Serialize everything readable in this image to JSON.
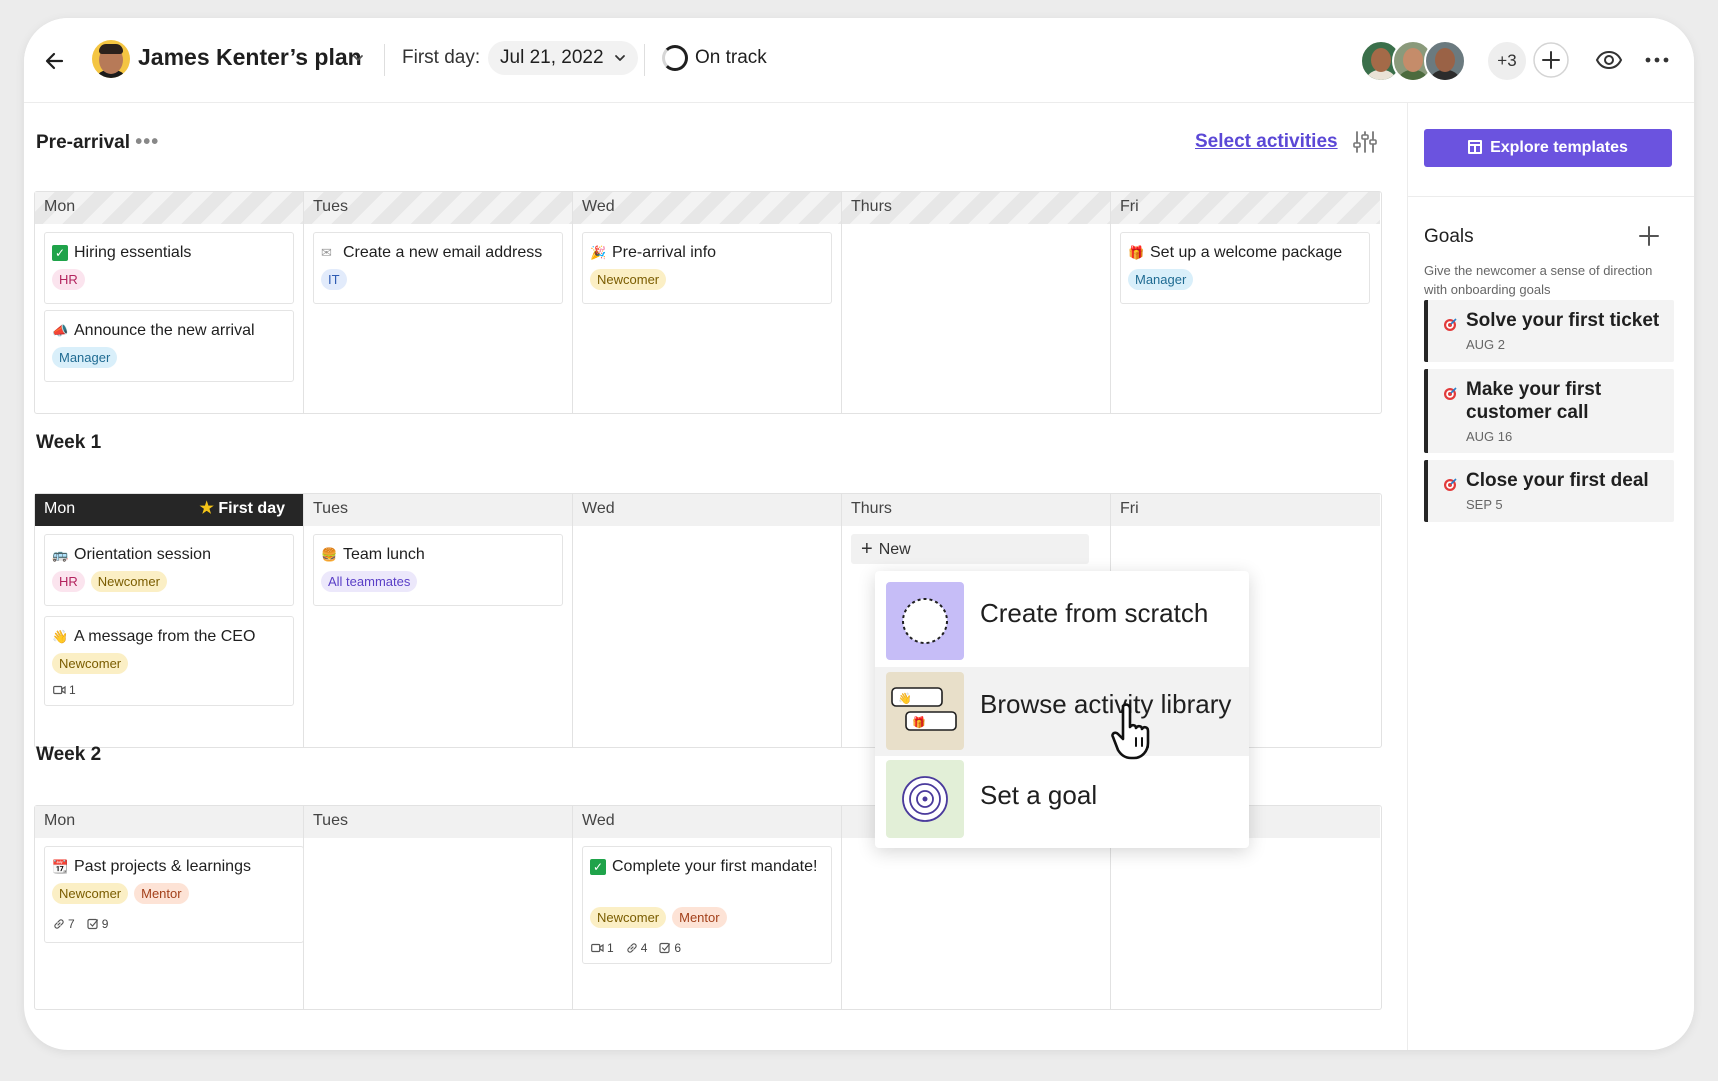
{
  "header": {
    "plan_title": "James Kenter’s plan",
    "first_day_label": "First day:",
    "first_day_value": "Jul 21, 2022",
    "status": "On track",
    "extra_members": "+3"
  },
  "sections": {
    "pre_arrival": {
      "title": "Pre-arrival",
      "select_link": "Select activities",
      "days": [
        "Mon",
        "Tues",
        "Wed",
        "Thurs",
        "Fri"
      ],
      "cards": {
        "hiring": {
          "title": "Hiring essentials",
          "tags": [
            "HR"
          ]
        },
        "announce": {
          "title": "Announce the new arrival",
          "tags": [
            "Manager"
          ]
        },
        "email": {
          "title": "Create a new email address",
          "tags": [
            "IT"
          ]
        },
        "prearrival_info": {
          "title": "Pre-arrival info",
          "tags": [
            "Newcomer"
          ]
        },
        "welcome": {
          "title": "Set up a welcome package",
          "tags": [
            "Manager"
          ]
        }
      }
    },
    "week1": {
      "title": "Week 1",
      "days": [
        "Mon",
        "Tues",
        "Wed",
        "Thurs",
        "Fri"
      ],
      "first_day_badge": "First day",
      "new_button": "New",
      "cards": {
        "orientation": {
          "title": "Orientation session",
          "tags": [
            "HR",
            "Newcomer"
          ]
        },
        "ceo": {
          "title": "A message from the CEO",
          "tags": [
            "Newcomer"
          ],
          "videos": "1"
        },
        "lunch": {
          "title": "Team lunch",
          "tags": [
            "All teammates"
          ]
        }
      }
    },
    "week2": {
      "title": "Week 2",
      "days": [
        "Mon",
        "Tues",
        "Wed"
      ],
      "cards": {
        "past_projects": {
          "title": "Past projects & learnings",
          "tags": [
            "Newcomer",
            "Mentor"
          ],
          "links": "7",
          "tasks": "9"
        },
        "mandate": {
          "title": "Complete your first mandate!",
          "tags": [
            "Newcomer",
            "Mentor"
          ],
          "videos": "1",
          "links": "4",
          "tasks": "6"
        }
      }
    }
  },
  "popup_menu": {
    "items": [
      {
        "label": "Create from scratch"
      },
      {
        "label": "Browse activity library"
      },
      {
        "label": "Set a goal"
      }
    ]
  },
  "right_panel": {
    "explore_button": "Explore templates",
    "goals_title": "Goals",
    "goals_description": "Give the newcomer a sense of direction with onboarding goals",
    "goals": [
      {
        "title": "Solve your first ticket",
        "date": "AUG 2"
      },
      {
        "title": "Make your first customer call",
        "date": "AUG 16"
      },
      {
        "title": "Close your first deal",
        "date": "SEP 5"
      }
    ]
  },
  "colors": {
    "accent": "#6b53df",
    "link": "#5b48d6",
    "first_day_header": "#262626"
  },
  "icons": [
    "back-arrow-icon",
    "chevron-down-icon",
    "progress-ring-icon",
    "plus-icon",
    "eye-icon",
    "more-horizontal-icon",
    "sliders-icon",
    "star-icon",
    "video-icon",
    "link-icon",
    "checkbox-icon",
    "target-icon",
    "hand-cursor-icon"
  ]
}
